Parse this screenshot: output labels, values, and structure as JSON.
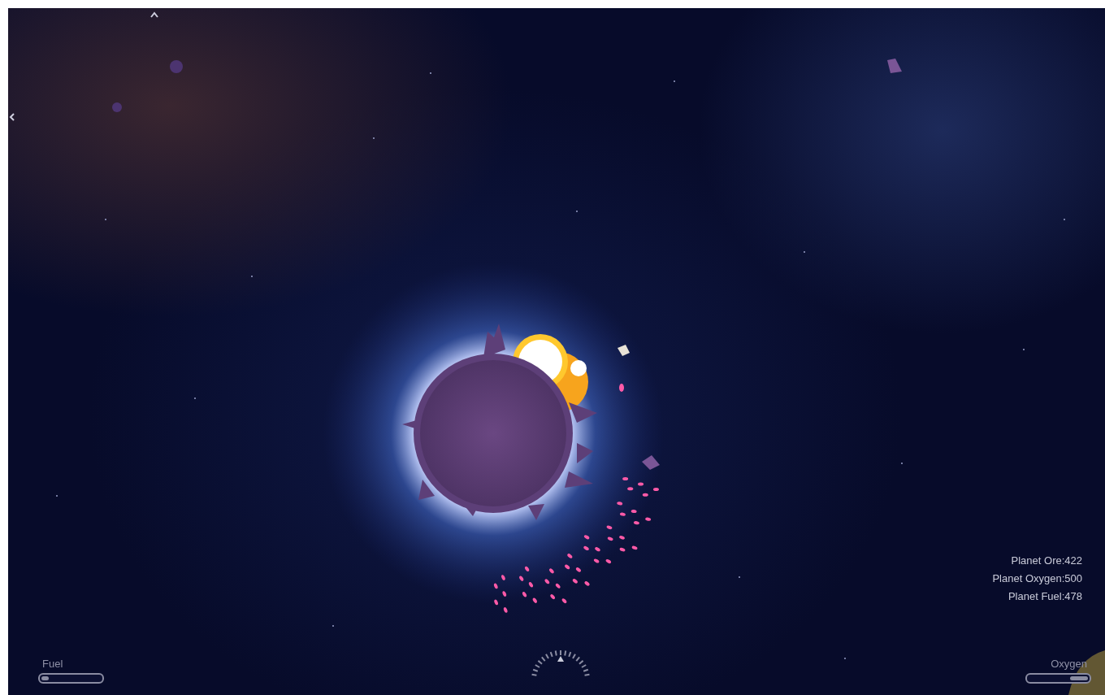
{
  "planet_stats": [
    {
      "text": "Planet Ore:422"
    },
    {
      "text": "Planet Oxygen:500"
    },
    {
      "text": "Planet Fuel:478"
    }
  ],
  "fuel_meter": {
    "label": "Fuel",
    "level": 0.12
  },
  "oxygen_meter": {
    "label": "Oxygen",
    "level": 0.3
  }
}
